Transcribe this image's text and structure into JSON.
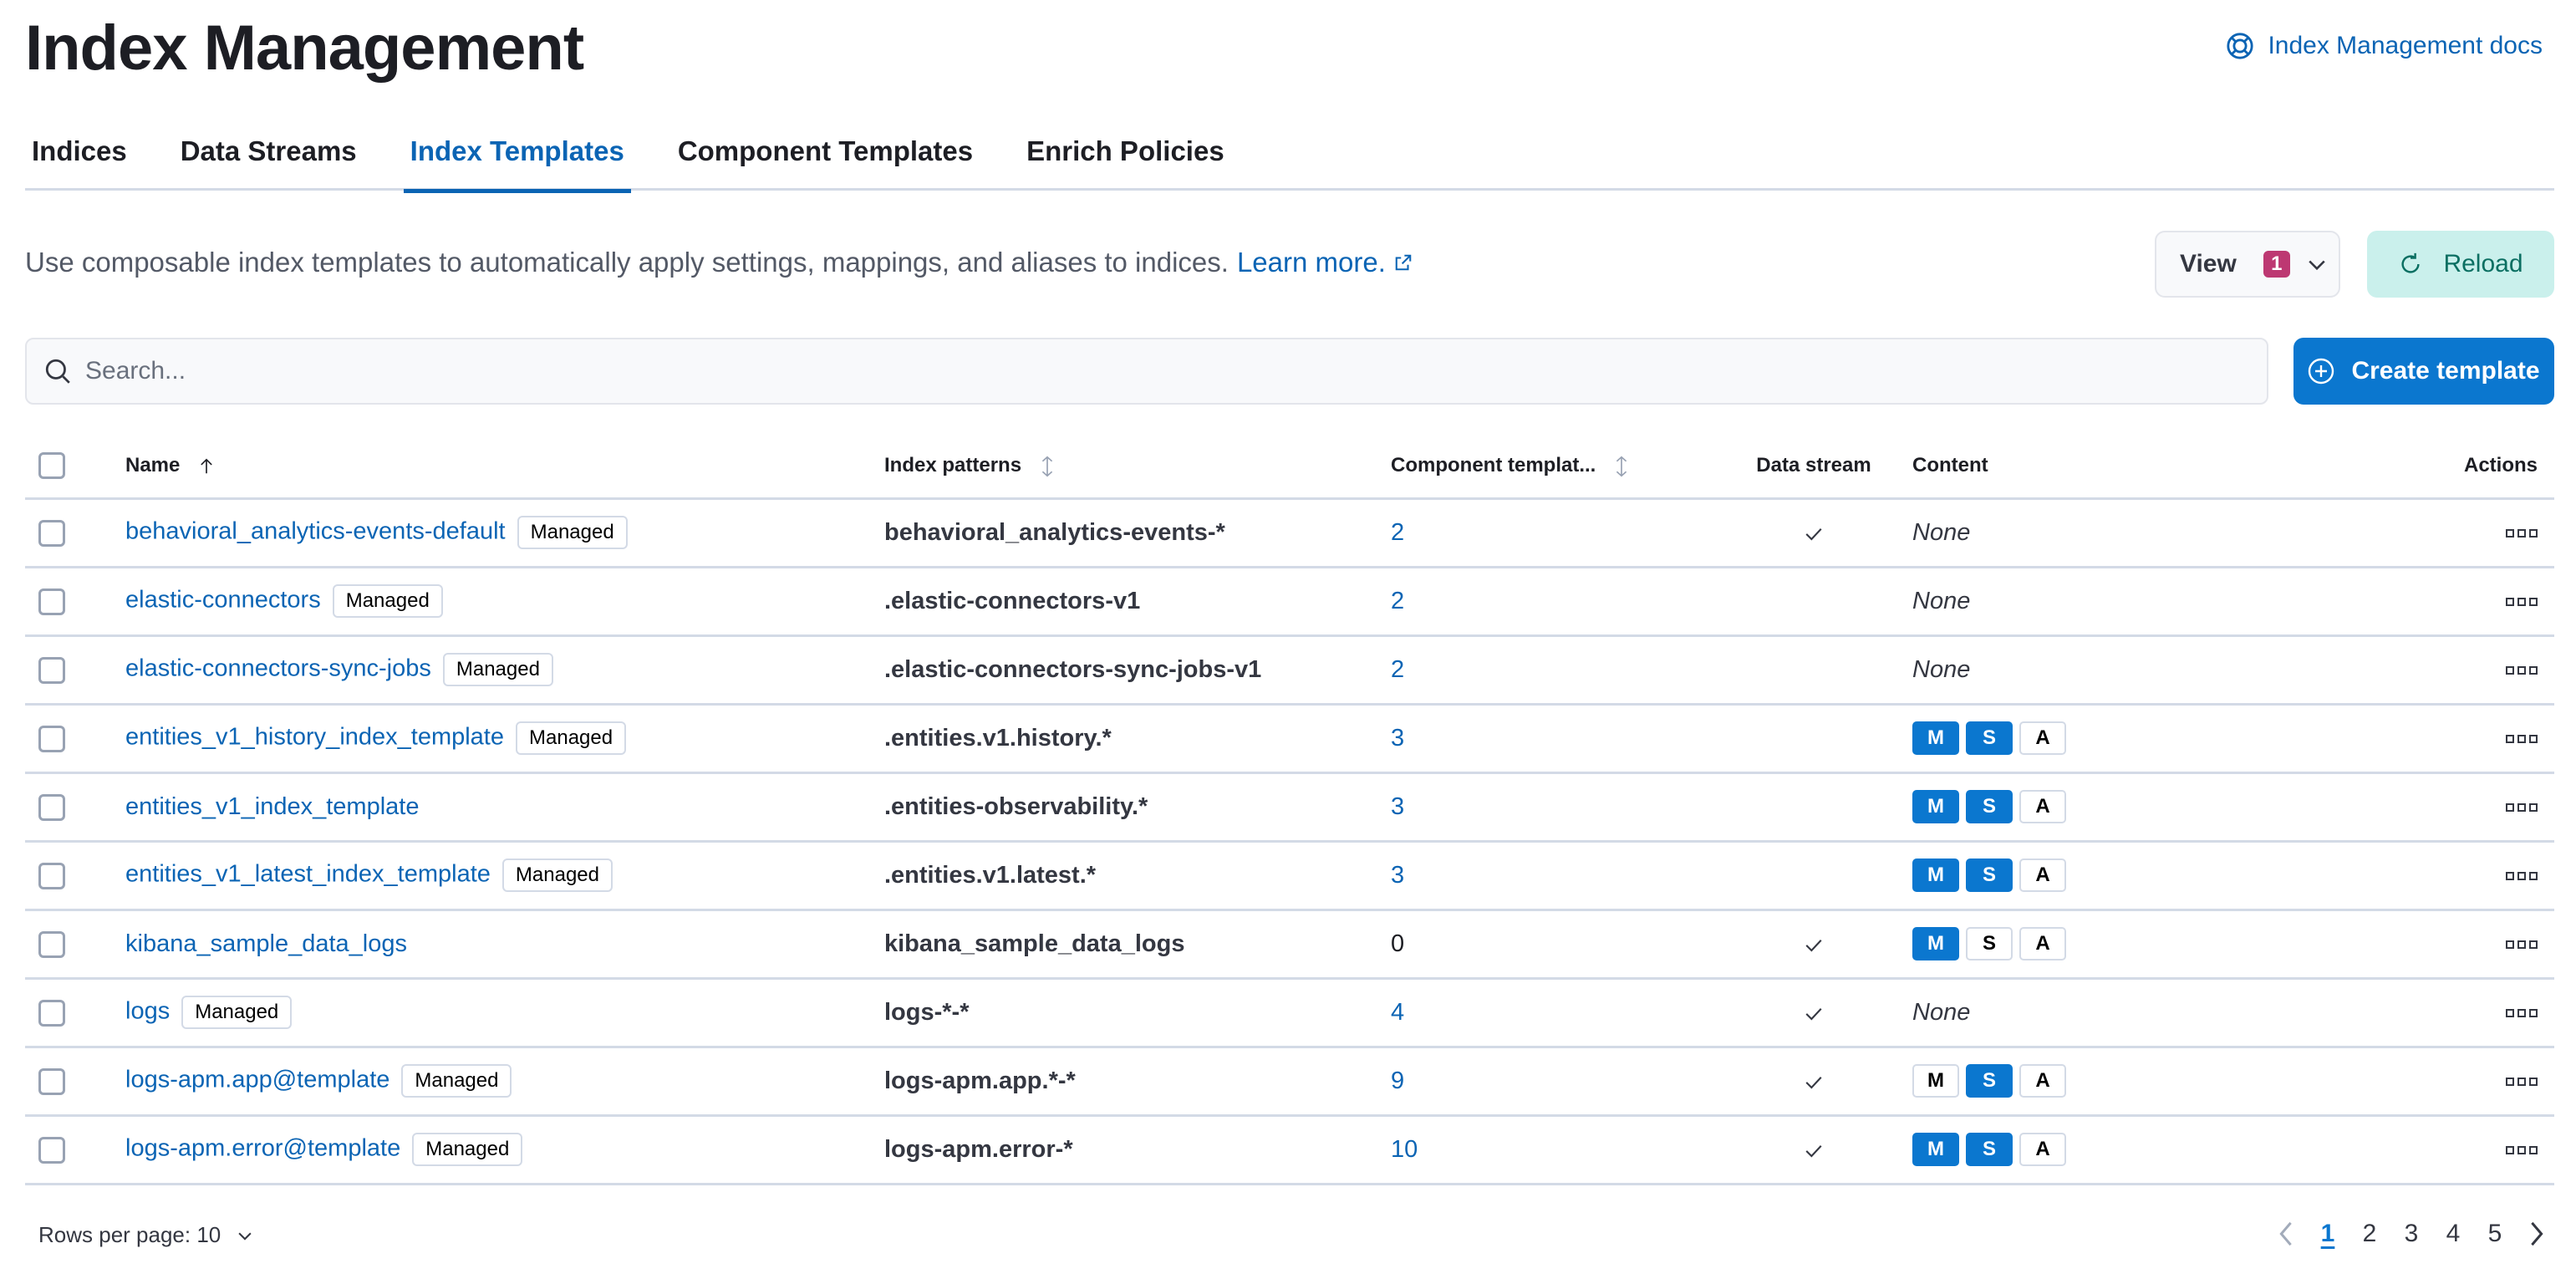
{
  "page": {
    "title": "Index Management",
    "docs_link": "Index Management docs"
  },
  "tabs": [
    {
      "label": "Indices",
      "active": false
    },
    {
      "label": "Data Streams",
      "active": false
    },
    {
      "label": "Index Templates",
      "active": true
    },
    {
      "label": "Component Templates",
      "active": false
    },
    {
      "label": "Enrich Policies",
      "active": false
    }
  ],
  "description": {
    "text": "Use composable index templates to automatically apply settings, mappings, and aliases to indices.",
    "learn_more": "Learn more."
  },
  "toolbar": {
    "view_label": "View",
    "view_badge": "1",
    "reload_label": "Reload",
    "search_placeholder": "Search...",
    "search_value": "",
    "create_label": "Create template"
  },
  "colors": {
    "accent": "#0b77cf",
    "link": "#0b64b4",
    "view_badge": "#bd3872",
    "reload_bg": "#caf0ec",
    "reload_text": "#0b6f62"
  },
  "table": {
    "columns": {
      "name": "Name",
      "index_patterns": "Index patterns",
      "component_templates": "Component templat...",
      "data_stream": "Data stream",
      "content": "Content",
      "actions": "Actions"
    },
    "sort": {
      "column": "name",
      "direction": "ascending"
    },
    "managed_label": "Managed",
    "none_label": "None",
    "rows": [
      {
        "name": "behavioral_analytics-events-default",
        "managed": true,
        "pattern": "behavioral_analytics-events-*",
        "components": "2",
        "components_link": true,
        "data_stream": true,
        "content": null
      },
      {
        "name": "elastic-connectors",
        "managed": true,
        "pattern": ".elastic-connectors-v1",
        "components": "2",
        "components_link": true,
        "data_stream": false,
        "content": null
      },
      {
        "name": "elastic-connectors-sync-jobs",
        "managed": true,
        "pattern": ".elastic-connectors-sync-jobs-v1",
        "components": "2",
        "components_link": true,
        "data_stream": false,
        "content": null
      },
      {
        "name": "entities_v1_history_index_template",
        "managed": true,
        "pattern": ".entities.v1.history.*",
        "components": "3",
        "components_link": true,
        "data_stream": false,
        "content": {
          "M": true,
          "S": true,
          "A": false
        }
      },
      {
        "name": "entities_v1_index_template",
        "managed": false,
        "pattern": ".entities-observability.*",
        "components": "3",
        "components_link": true,
        "data_stream": false,
        "content": {
          "M": true,
          "S": true,
          "A": false
        }
      },
      {
        "name": "entities_v1_latest_index_template",
        "managed": true,
        "pattern": ".entities.v1.latest.*",
        "components": "3",
        "components_link": true,
        "data_stream": false,
        "content": {
          "M": true,
          "S": true,
          "A": false
        }
      },
      {
        "name": "kibana_sample_data_logs",
        "managed": false,
        "pattern": "kibana_sample_data_logs",
        "components": "0",
        "components_link": false,
        "data_stream": true,
        "content": {
          "M": true,
          "S": false,
          "A": false
        }
      },
      {
        "name": "logs",
        "managed": true,
        "pattern": "logs-*-*",
        "components": "4",
        "components_link": true,
        "data_stream": true,
        "content": null
      },
      {
        "name": "logs-apm.app@template",
        "managed": true,
        "pattern": "logs-apm.app.*-*",
        "components": "9",
        "components_link": true,
        "data_stream": true,
        "content": {
          "M": false,
          "S": true,
          "A": false
        }
      },
      {
        "name": "logs-apm.error@template",
        "managed": true,
        "pattern": "logs-apm.error-*",
        "components": "10",
        "components_link": true,
        "data_stream": true,
        "content": {
          "M": true,
          "S": true,
          "A": false
        }
      }
    ]
  },
  "footer": {
    "rows_per_page": "Rows per page: 10",
    "pages": [
      "1",
      "2",
      "3",
      "4",
      "5"
    ],
    "current_page": "1"
  }
}
